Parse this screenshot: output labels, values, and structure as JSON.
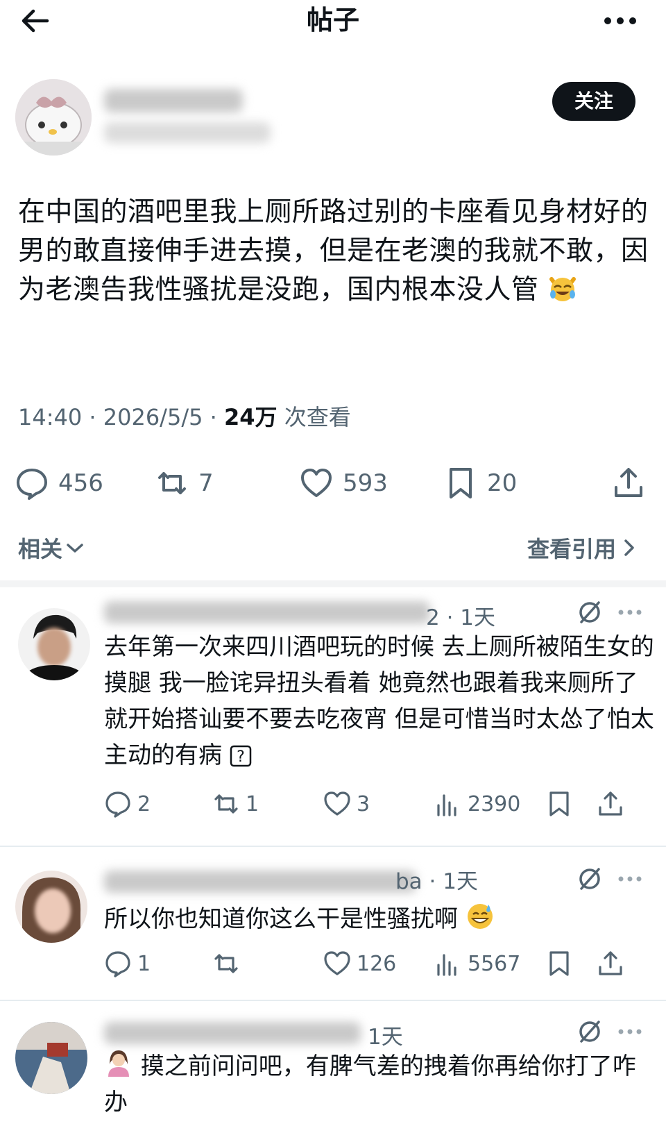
{
  "header": {
    "title": "帖子"
  },
  "author": {
    "follow_label": "关注"
  },
  "post": {
    "text": "在中国的酒吧里我上厕所路过别的卡座看见身材好的男的敢直接伸手进去摸，但是在老澳的我就不敢，因为老澳告我性骚扰是没跑，国内根本没人管",
    "time": "14:40",
    "date": "2026/5/5",
    "views_count": "24万",
    "views_label": "次查看",
    "replies": "456",
    "reposts": "7",
    "likes": "593",
    "bookmarks": "20"
  },
  "links": {
    "related": "相关",
    "view_quotes": "查看引用"
  },
  "replies": [
    {
      "handle_fragment": "2",
      "time": "1天",
      "text": "去年第一次来四川酒吧玩的时候 去上厕所被陌生女的摸腿 我一脸诧异扭头看着 她竟然也跟着我来厕所了 就开始搭讪要不要去吃夜宵 但是可惜当时太怂了怕太主动的有病",
      "replies": "2",
      "reposts": "1",
      "likes": "3",
      "views": "2390"
    },
    {
      "handle_fragment": "ba",
      "time": "1天",
      "text": "所以你也知道你这么干是性骚扰啊",
      "replies": "1",
      "reposts": "",
      "likes": "126",
      "views": "5567"
    },
    {
      "handle_fragment": "",
      "time": "1天",
      "text": "摸之前问问吧，有脾气差的拽着你再给你打了咋办"
    }
  ],
  "colors": {
    "text": "#0f1419",
    "secondary": "#536471",
    "follow_bg": "#0f1419",
    "divider": "#e6ecf0"
  }
}
